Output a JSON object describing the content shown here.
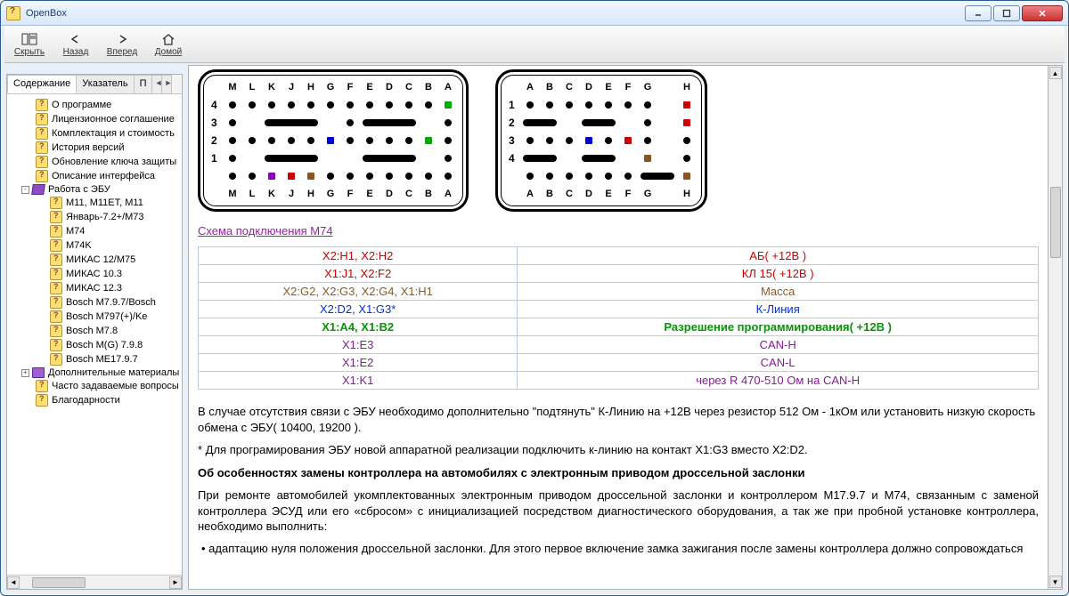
{
  "window": {
    "title": "OpenBox"
  },
  "toolbar": {
    "hide": "Скрыть",
    "back": "Назад",
    "forward": "Вперед",
    "home": "Домой"
  },
  "tabs": {
    "content": "Содержание",
    "index": "Указатель",
    "search": "П"
  },
  "tree": {
    "about": "О программе",
    "license": "Лицензионное соглашение",
    "kit": "Комплектация и стоимость",
    "history": "История версий",
    "keyupdate": "Обновление ключа защиты",
    "interface": "Описание интерфейса",
    "ecu": "Работа с ЭБУ",
    "m11": "M11, М11ЕТ, M11",
    "yan": "Январь-7.2+/М73",
    "m74": "M74",
    "m74k": "M74K",
    "mikas12": "МИКАС 12/М75",
    "mikas103": "МИКАС 10.3",
    "mikas123": "МИКАС 12.3",
    "bosch797": "Bosch M7.9.7/Bosch",
    "bosch797ke": "Bosch M797(+)/Ke",
    "bosch78": "Bosch M7.8",
    "bosch798": "Bosch M(G) 7.9.8",
    "bosch1797": "Bosch ME17.9.7",
    "extra": "Дополнительные материалы",
    "faq": "Часто задаваемые вопросы",
    "thanks": "Благодарности"
  },
  "content": {
    "schemeLink": "Схема подключения М74",
    "pinTable": [
      {
        "pin": "X2:H1, X2:H2",
        "desc": "АБ( +12В )",
        "cls": "c-red"
      },
      {
        "pin": "X1:J1, X2:F2",
        "desc": "КЛ 15( +12В )",
        "cls": "c-red"
      },
      {
        "pin": "X2:G2, X2:G3, X2:G4, X1:H1",
        "desc": "Масса",
        "cls": "c-brown"
      },
      {
        "pin": "X2:D2, X1:G3*",
        "desc": "К-Линия",
        "cls": "c-blue"
      },
      {
        "pin": "X1:A4, X1:B2",
        "desc": "Разрешение программирования( +12В )",
        "cls": "c-green"
      },
      {
        "pin": "X1:E3",
        "desc": "CAN-H",
        "cls": "c-purple"
      },
      {
        "pin": "X1:E2",
        "desc": "CAN-L",
        "cls": "c-purple"
      },
      {
        "pin": "X1:K1",
        "desc": "через R 470-510 Ом на CAN-H",
        "cls": "c-purple"
      }
    ],
    "para1": "В случае отсутствия связи с ЭБУ необходимо дополнительно \"подтянуть\" К-Линию на +12В через резистор 512 Ом - 1кОм или установить низкую скорость обмена с ЭБУ( 10400, 19200 ).",
    "para2": "* Для програмирования ЭБУ новой аппаратной реализации подключить к-линию на контакт X1:G3 вместо X2:D2.",
    "heading": "Об особенностях замены контроллера на автомобилях с электронным приводом дроссельной заслонки",
    "para3": "При ремонте автомобилей укомплектованных электронным приводом дроссельной заслонки и контроллером М17.9.7 и М74, связанным с заменой контроллера ЭСУД или его «сбросом» с инициализацией посредством диагностического оборудования, а так же при пробной установке контроллера, необходимо выполнить:",
    "bullet1": "• адаптацию нуля положения дроссельной заслонки. Для этого первое включение замка зажигания после замены контроллера должно сопровождаться"
  },
  "connectors": {
    "left": {
      "topLabels": [
        "M",
        "L",
        "K",
        "J",
        "H",
        "G",
        "F",
        "E",
        "D",
        "C",
        "B",
        "A"
      ],
      "botLabels": [
        "M",
        "L",
        "K",
        "J",
        "H",
        "G",
        "F",
        "E",
        "D",
        "C",
        "B",
        "A"
      ],
      "rows": [
        {
          "n": "4",
          "cells": [
            "p",
            "p",
            "p",
            "p",
            "p",
            "p",
            "p",
            "p",
            "p",
            "p",
            "p",
            "sq#0a0"
          ]
        },
        {
          "n": "3",
          "cells": [
            "p",
            "",
            "slot3",
            "",
            "",
            "",
            "p",
            "slot3",
            "",
            "",
            "",
            "p"
          ]
        },
        {
          "n": "2",
          "cells": [
            "p",
            "p",
            "p",
            "p",
            "p",
            "sq#00c",
            "p",
            "p",
            "p",
            "p",
            "sq#0a0",
            "p"
          ]
        },
        {
          "n": "1",
          "cells": [
            "p",
            "",
            "slot3",
            "",
            "",
            "",
            "",
            "slot3",
            "",
            "",
            "",
            "p"
          ]
        },
        {
          "n": "",
          "cells": [
            "p",
            "p",
            "sq#80b",
            "sq#c00",
            "sq#852",
            "p",
            "p",
            "p",
            "p",
            "p",
            "p",
            "p"
          ],
          "below": true
        }
      ]
    },
    "right": {
      "topLabels": [
        "A",
        "B",
        "C",
        "D",
        "E",
        "F",
        "G",
        "",
        "H"
      ],
      "botLabels": [
        "A",
        "B",
        "C",
        "D",
        "E",
        "F",
        "G",
        "",
        "H"
      ],
      "rows": [
        {
          "n": "1",
          "cells": [
            "p",
            "p",
            "p",
            "p",
            "p",
            "p",
            "p",
            "",
            "sq#c00"
          ]
        },
        {
          "n": "2",
          "cells": [
            "slot2",
            "",
            "",
            "slot2",
            "",
            "",
            "p",
            "",
            "sq#c00"
          ]
        },
        {
          "n": "3",
          "cells": [
            "p",
            "p",
            "p",
            "sq#00c",
            "p",
            "sq#c00",
            "p",
            "",
            "p"
          ]
        },
        {
          "n": "4",
          "cells": [
            "slot2",
            "",
            "",
            "slot2",
            "",
            "",
            "sq#852",
            "",
            "p"
          ]
        },
        {
          "n": "",
          "cells": [
            "p",
            "p",
            "p",
            "p",
            "p",
            "p",
            "slot2h",
            "",
            "sq#852"
          ],
          "below": true
        }
      ]
    }
  }
}
